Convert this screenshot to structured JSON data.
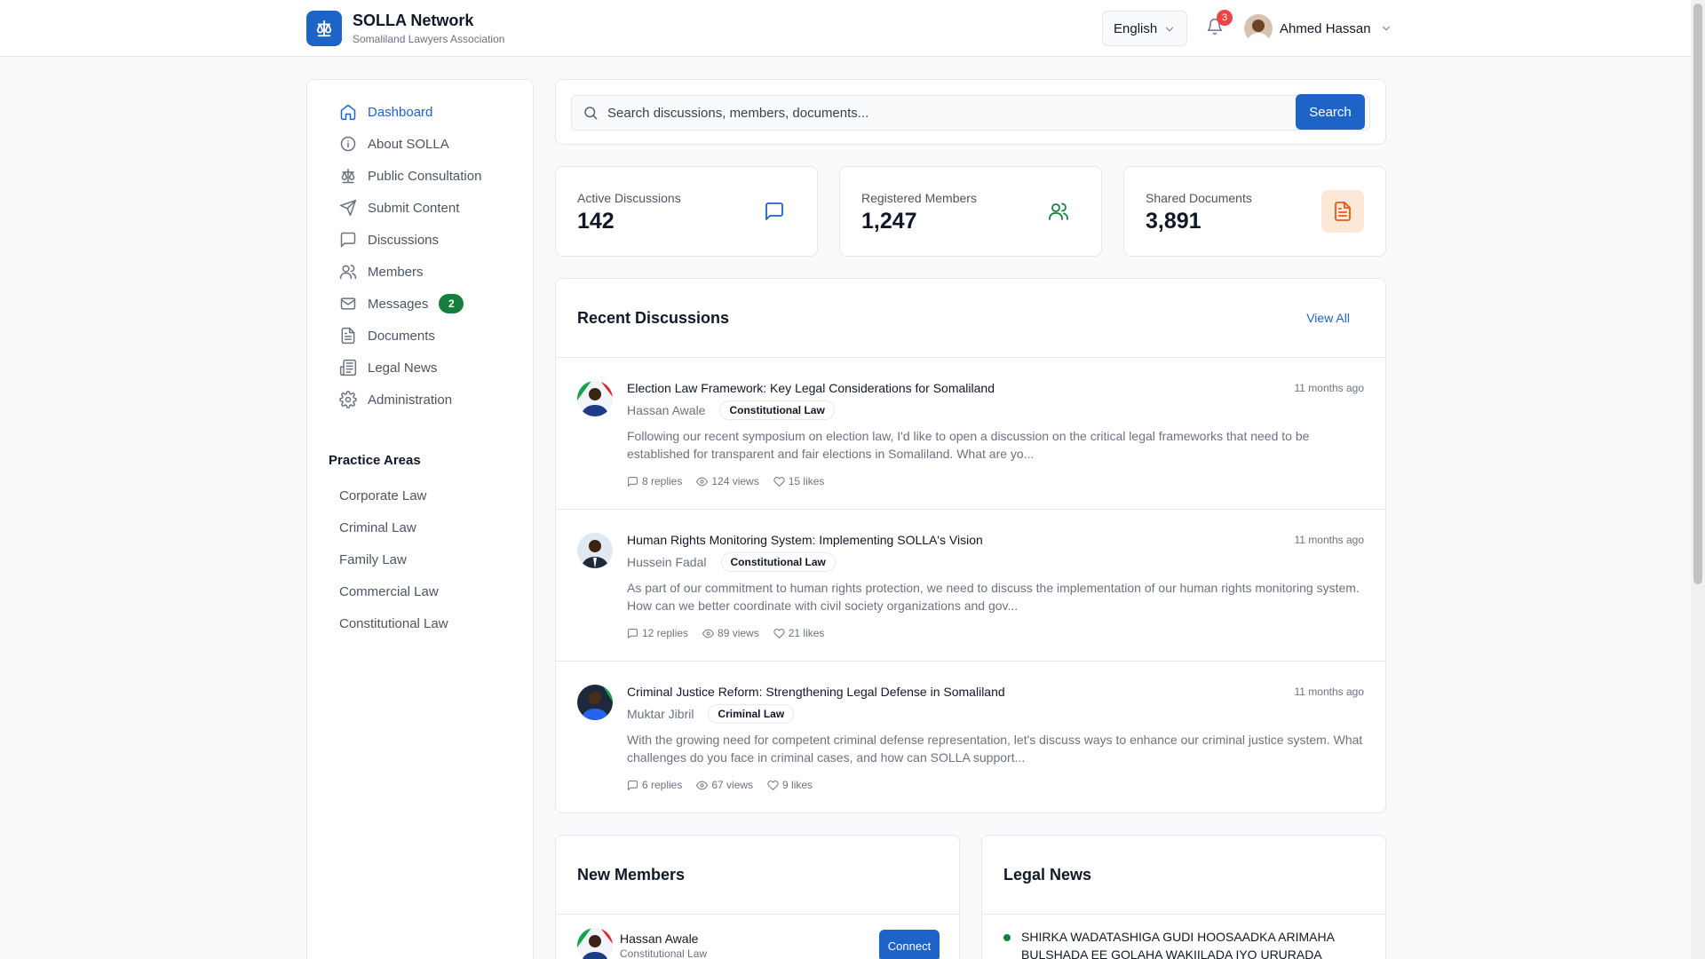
{
  "brand": {
    "title": "SOLLA Network",
    "subtitle": "Somaliland Lawyers Association",
    "logo_icon": "scale-icon",
    "accent": "#1d63c8"
  },
  "header": {
    "language": "English",
    "notification_count": "3",
    "user_name": "Ahmed Hassan"
  },
  "sidebar": {
    "items": [
      {
        "label": "Dashboard",
        "icon": "home-icon",
        "active": true
      },
      {
        "label": "About SOLLA",
        "icon": "info-icon"
      },
      {
        "label": "Public Consultation",
        "icon": "scale-icon"
      },
      {
        "label": "Submit Content",
        "icon": "send-icon"
      },
      {
        "label": "Discussions",
        "icon": "message-square-icon"
      },
      {
        "label": "Members",
        "icon": "users-icon"
      },
      {
        "label": "Messages",
        "icon": "mail-icon",
        "badge": "2"
      },
      {
        "label": "Documents",
        "icon": "file-text-icon"
      },
      {
        "label": "Legal News",
        "icon": "newspaper-icon"
      },
      {
        "label": "Administration",
        "icon": "gear-icon"
      }
    ],
    "practice_title": "Practice Areas",
    "practice_areas": [
      "Corporate Law",
      "Criminal Law",
      "Family Law",
      "Commercial Law",
      "Constitutional Law"
    ]
  },
  "search": {
    "placeholder": "Search discussions, members, documents...",
    "button": "Search"
  },
  "stats": [
    {
      "label": "Active Discussions",
      "value": "142",
      "icon": "message-square-icon",
      "color": "#1d63c8"
    },
    {
      "label": "Registered Members",
      "value": "1,247",
      "icon": "users-icon",
      "color": "#15803d"
    },
    {
      "label": "Shared Documents",
      "value": "3,891",
      "icon": "file-text-icon",
      "color": "#ea580c"
    }
  ],
  "recent": {
    "title": "Recent Discussions",
    "view_all": "View All",
    "items": [
      {
        "title": "Election Law Framework: Key Legal Considerations for Somaliland",
        "author": "Hassan Awale",
        "tag": "Constitutional Law",
        "time": "11 months ago",
        "excerpt": "Following our recent symposium on election law, I'd like to open a discussion on the critical legal frameworks that need to be established for transparent and fair elections in Somaliland. What are yo...",
        "replies": "8 replies",
        "views": "124 views",
        "likes": "15 likes"
      },
      {
        "title": "Human Rights Monitoring System: Implementing SOLLA's Vision",
        "author": "Hussein Fadal",
        "tag": "Constitutional Law",
        "time": "11 months ago",
        "excerpt": "As part of our commitment to human rights protection, we need to discuss the implementation of our human rights monitoring system. How can we better coordinate with civil society organizations and gov...",
        "replies": "12 replies",
        "views": "89 views",
        "likes": "21 likes"
      },
      {
        "title": "Criminal Justice Reform: Strengthening Legal Defense in Somaliland",
        "author": "Muktar Jibril",
        "tag": "Criminal Law",
        "time": "11 months ago",
        "excerpt": "With the growing need for competent criminal defense representation, let's discuss ways to enhance our criminal justice system. What challenges do you face in criminal cases, and how can SOLLA support...",
        "replies": "6 replies",
        "views": "67 views",
        "likes": "9 likes"
      }
    ]
  },
  "members": {
    "title": "New Members",
    "items": [
      {
        "name": "Hassan Awale",
        "area": "Constitutional Law",
        "button": "Connect"
      }
    ]
  },
  "news": {
    "title": "Legal News",
    "items": [
      {
        "text": "SHIRKA WADATASHIGA GUDI HOOSAADKA ARIMAHA BULSHADA EE GOLAHA WAKIILADA IYO URURADA"
      }
    ]
  }
}
